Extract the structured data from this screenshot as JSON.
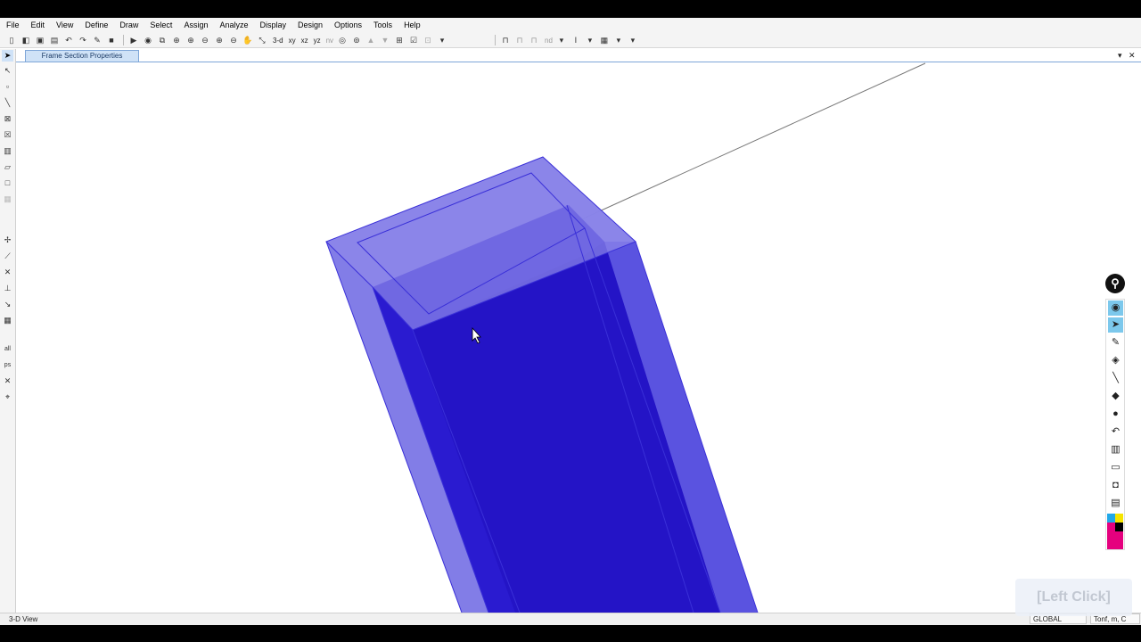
{
  "menu": [
    "File",
    "Edit",
    "View",
    "Define",
    "Draw",
    "Select",
    "Assign",
    "Analyze",
    "Display",
    "Design",
    "Options",
    "Tools",
    "Help"
  ],
  "toolbar": {
    "view_3d": "3-d",
    "view_xy": "xy",
    "view_xz": "xz",
    "view_yz": "yz",
    "view_nv": "nv",
    "nd": "nd"
  },
  "tab": {
    "label": "Frame Section Properties",
    "dropdown_glyph": "▾",
    "close_glyph": "✕"
  },
  "status": {
    "view_name": "3-D View",
    "coord_system": "GLOBAL",
    "units": "Tonf, m, C"
  },
  "overlay": {
    "click_label": "[Left Click]"
  },
  "pen_toolbar": {
    "icons": [
      "eye-icon",
      "pointer-icon",
      "pen-icon",
      "highlighter-icon",
      "line-icon",
      "eraser-icon",
      "dot-icon",
      "undo-icon",
      "trash-icon",
      "whiteboard-icon",
      "camera-icon",
      "notes-icon"
    ],
    "colors": [
      "#21a8e8",
      "#f5e400",
      "#000000",
      "#e5007e"
    ]
  },
  "colors": {
    "member_light": "#7b76e6",
    "member_dark": "#2a1bd0",
    "tab_bg": "#cfe2f7"
  }
}
